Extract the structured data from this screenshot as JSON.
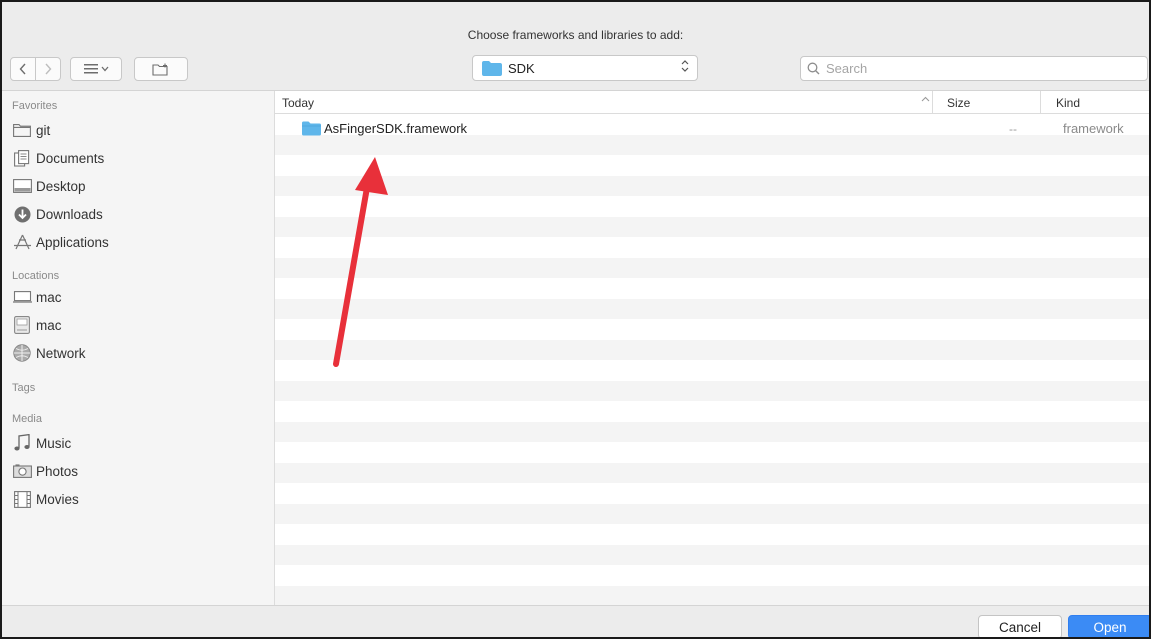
{
  "dialog": {
    "title": "Choose frameworks and libraries to add:"
  },
  "toolbar": {
    "back_icon": "chevron-left-icon",
    "forward_icon": "chevron-right-icon",
    "view_icon": "list-view-icon",
    "new_folder_icon": "new-folder-icon",
    "location": "SDK",
    "search_placeholder": "Search"
  },
  "sidebar": {
    "sections": [
      {
        "header": "Favorites",
        "items": [
          {
            "label": "git",
            "icon": "folder-icon"
          },
          {
            "label": "Documents",
            "icon": "documents-icon"
          },
          {
            "label": "Desktop",
            "icon": "desktop-icon"
          },
          {
            "label": "Downloads",
            "icon": "downloads-icon"
          },
          {
            "label": "Applications",
            "icon": "applications-icon"
          }
        ]
      },
      {
        "header": "Locations",
        "items": [
          {
            "label": "mac",
            "icon": "computer-icon"
          },
          {
            "label": "mac",
            "icon": "hard-drive-icon"
          },
          {
            "label": "Network",
            "icon": "network-icon"
          }
        ]
      },
      {
        "header": "Tags",
        "items": []
      },
      {
        "header": "Media",
        "items": [
          {
            "label": "Music",
            "icon": "music-icon"
          },
          {
            "label": "Photos",
            "icon": "photos-icon"
          },
          {
            "label": "Movies",
            "icon": "movies-icon"
          }
        ]
      }
    ]
  },
  "list": {
    "columns": {
      "name": "Today",
      "size": "Size",
      "kind": "Kind"
    },
    "files": [
      {
        "name": "AsFingerSDK.framework",
        "size": "--",
        "kind": "framework",
        "icon": "folder-icon"
      }
    ]
  },
  "footer": {
    "cancel": "Cancel",
    "open": "Open"
  },
  "colors": {
    "accent": "#3b8bf5",
    "folder": "#5fb6ea",
    "annotation_arrow": "#e8303a"
  }
}
